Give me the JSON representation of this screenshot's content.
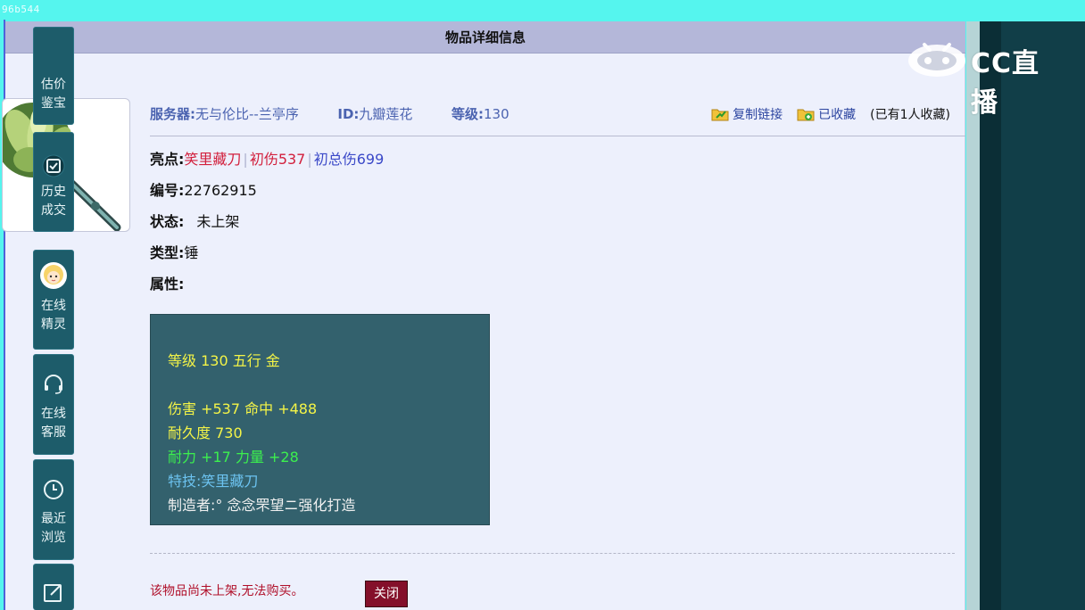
{
  "overlay": {
    "top_tag": "96b544"
  },
  "header": {
    "title": "物品详细信息"
  },
  "info": {
    "server_label": "服务器:",
    "server_value": "无与伦比--兰亭序",
    "id_label": "ID:",
    "id_value": "九瓣莲花",
    "level_label": "等级:",
    "level_value": "130"
  },
  "actions": {
    "copy_link": "复制链接",
    "favorited": "已收藏",
    "fav_count": "(已有1人收藏)"
  },
  "fields": {
    "highlight_label": "亮点:",
    "highlight_1": "笑里藏刀",
    "highlight_sep": "|",
    "highlight_2": "初伤537",
    "highlight_3": "初总伤699",
    "serial_label": "编号:",
    "serial_value": "22762915",
    "status_label": "状态:",
    "status_value": "未上架",
    "type_label": "类型:",
    "type_value": "锤",
    "attr_label": "属性:"
  },
  "attributes": {
    "line1": "等级 130 五行 金",
    "line2": "伤害 +537 命中 +488",
    "line3": "耐久度 730",
    "line4": "耐力 +17 力量 +28",
    "line5": "特技:笑里藏刀",
    "line6": "制造者:° 念念罘望ニ强化打造"
  },
  "footer": {
    "notice": "该物品尚未上架,无法购买。",
    "close_label": "关闭"
  },
  "sidebar": {
    "items": [
      {
        "label": "估价鉴宝"
      },
      {
        "label": "历史成交"
      },
      {
        "label": "在线精灵"
      },
      {
        "label": "在线客服"
      },
      {
        "label": "最近浏览"
      }
    ]
  },
  "watermark": {
    "brand": "CC直播"
  },
  "colors": {
    "accent_blue": "#4b63b0",
    "highlight_red": "#d21f3c",
    "attr_panel": "#33616d",
    "sidebar": "#113e48"
  }
}
